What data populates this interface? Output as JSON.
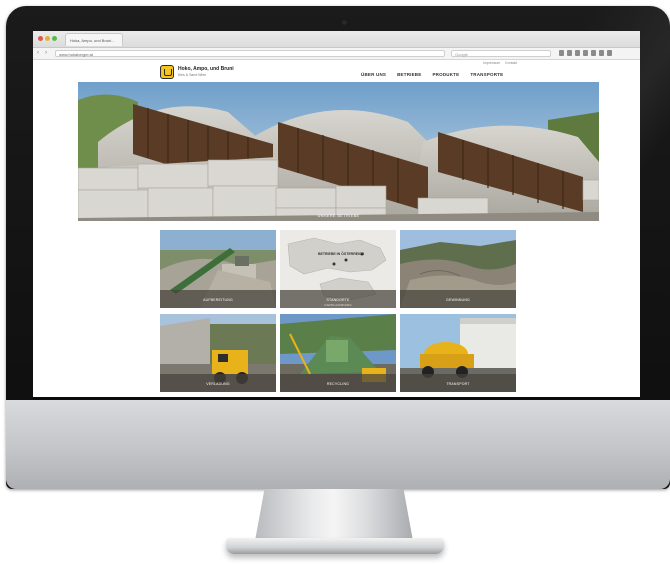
{
  "browser": {
    "tab_title": "Hoka, Ampo, und Bruni...",
    "url": "www.hokaberger.at",
    "search_placeholder": "Google"
  },
  "site": {
    "brand_name": "Hoko, Ampo, und Bruni",
    "brand_tagline": "Kies & Sand Wien",
    "top_links": [
      "Impressum",
      "Kontakt"
    ],
    "nav": [
      "ÜBER UNS",
      "BETRIEBE",
      "PRODUKTE",
      "TRANSPORTE"
    ],
    "hero_caption": "UNSERE BETRIEBE"
  },
  "tiles": [
    {
      "label": "AUFBEREITUNG",
      "sub": ""
    },
    {
      "label": "STANDORTE",
      "sub": "KARTE AUFRUFEN",
      "map_label": "BETRIEBE IN ÖSTERREICH"
    },
    {
      "label": "GEWINNUNG",
      "sub": ""
    },
    {
      "label": "VERLADUNG",
      "sub": ""
    },
    {
      "label": "RECYCLING",
      "sub": ""
    },
    {
      "label": "TRANSPORT",
      "sub": ""
    }
  ],
  "colors": {
    "bezel": "#111111",
    "accent_logo": "#f4c51c",
    "truck_yellow": "#e8b21a",
    "tile_bar": "#46423c"
  }
}
